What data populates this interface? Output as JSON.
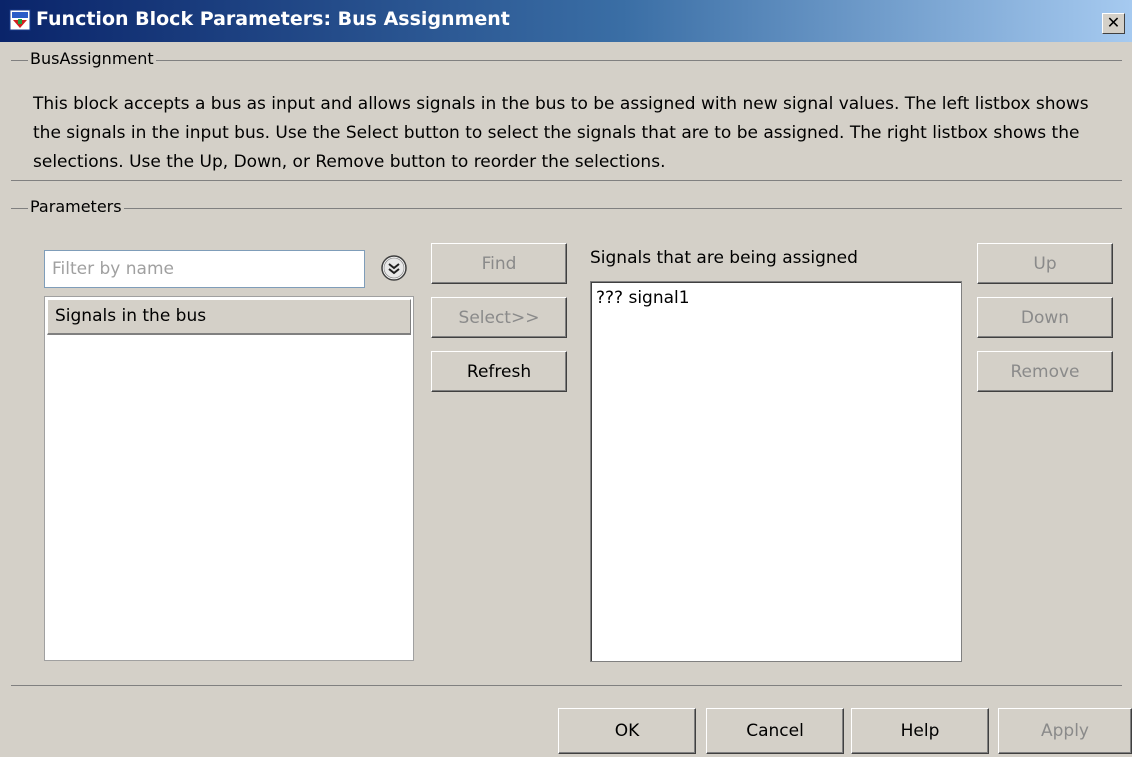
{
  "window": {
    "title": "Function Block Parameters: Bus Assignment",
    "close_glyph": "✕"
  },
  "bus_assignment": {
    "group_label": "BusAssignment",
    "description": "This block accepts a bus as input and allows signals in the bus to be assigned with new signal values. The left listbox shows the signals in the input bus. Use the Select button to select the signals that are to be assigned. The right listbox shows the selections. Use the Up, Down, or Remove button to reorder the selections."
  },
  "parameters": {
    "group_label": "Parameters",
    "filter": {
      "placeholder": "Filter by name",
      "value": ""
    },
    "bus_list": {
      "header": "Signals in the bus",
      "items": []
    },
    "buttons": {
      "find": "Find",
      "select": "Select>>",
      "refresh": "Refresh",
      "up": "Up",
      "down": "Down",
      "remove": "Remove"
    },
    "assigned_label": "Signals that are being assigned",
    "assigned_items": [
      "??? signal1"
    ]
  },
  "footer": {
    "ok": "OK",
    "cancel": "Cancel",
    "help": "Help",
    "apply": "Apply"
  },
  "colors": {
    "dialog_bg": "#d4d0c8",
    "title_gradient_start": "#0a246a",
    "title_gradient_end": "#a6caf0",
    "disabled_text": "#8a8a8a"
  },
  "icons": {
    "app": "simulink-block-icon",
    "filter_options": "double-chevron-down-icon",
    "close": "close-icon"
  }
}
